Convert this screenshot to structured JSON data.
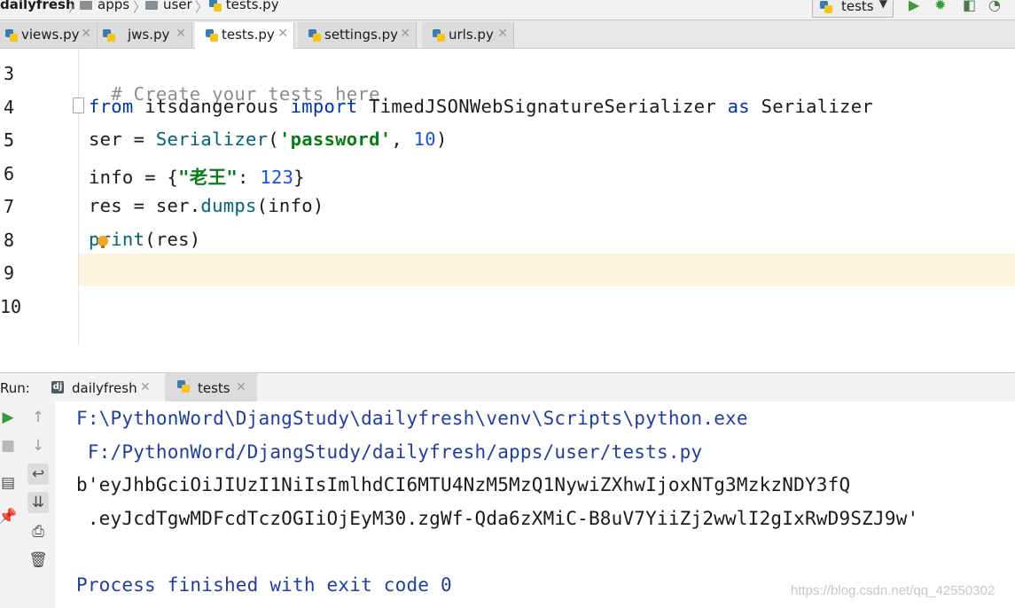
{
  "breadcrumb": {
    "project": "dailyfresh",
    "items": [
      "apps",
      "user",
      "tests.py"
    ]
  },
  "run_config": {
    "label": "tests"
  },
  "tabs": [
    {
      "label": "views.py"
    },
    {
      "label": "jws.py"
    },
    {
      "label": "tests.py"
    },
    {
      "label": "settings.py"
    },
    {
      "label": "urls.py"
    }
  ],
  "editor": {
    "line_numbers": [
      "3",
      "4",
      "5",
      "6",
      "7",
      "8",
      "9",
      "10"
    ],
    "lines": {
      "l3": "# Create your tests here.",
      "l4_kw1": "from",
      "l4_mod": " itsdangerous ",
      "l4_kw2": "import",
      "l4_cls": " TimedJSONWebSignatureSerializer ",
      "l4_kw3": "as",
      "l4_alias": " Serializer",
      "l5_var": "ser = ",
      "l5_fn": "Serializer",
      "l5_open": "(",
      "l5_str": "'password'",
      "l5_sep": ", ",
      "l5_num": "10",
      "l5_close": ")",
      "l6_var": "info = {",
      "l6_str": "\"老王\"",
      "l6_colon": ": ",
      "l6_num": "123",
      "l6_close": "}",
      "l7_var": "res = ser.",
      "l7_fn": "dumps",
      "l7_args": "(info)",
      "l8_fn": "print",
      "l8_args": "(res)"
    }
  },
  "run_panel": {
    "label": "Run:",
    "tabs": [
      {
        "label": "dailyfresh"
      },
      {
        "label": "tests"
      }
    ],
    "console": [
      "F:\\PythonWord\\DjangStudy\\dailyfresh\\venv\\Scripts\\python.exe",
      " F:/PythonWord/DjangStudy/dailyfresh/apps/user/tests.py",
      "b'eyJhbGciOiJIUzI1NiIsImlhdCI6MTU4NzM5MzQ1NywiZXhwIjoxNTg3MzkzNDY3fQ",
      " .eyJcdTgwMDFcdTczOGIiOjEyM30.zgWf-Qda6zXMiC-B8uV7YiiZj2wwlI2gIxRwD9SZJ9w'",
      "",
      "Process finished with exit code 0"
    ]
  },
  "watermark": "https://blog.csdn.net/qq_42550302",
  "colors": {
    "keyword": "#0033b3",
    "function": "#00627a",
    "string": "#067d17",
    "number": "#1750eb",
    "comment": "#8c8c8c",
    "current_line": "#fcf5dc",
    "console_blue": "#1f3fa0"
  }
}
